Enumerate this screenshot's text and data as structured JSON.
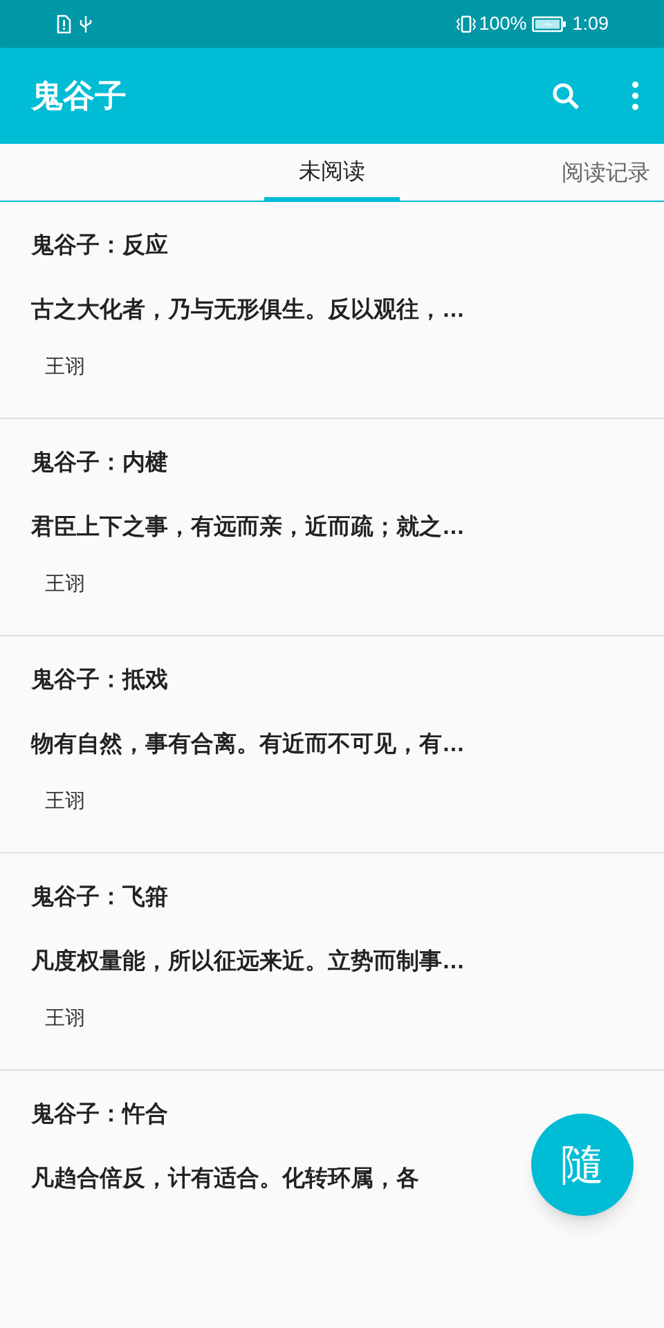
{
  "status_bar": {
    "battery": "100%",
    "time": "1:09"
  },
  "app_bar": {
    "title": "鬼谷子"
  },
  "tabs": [
    {
      "label": "未阅读",
      "selected": true
    },
    {
      "label": "阅读记录",
      "selected": false
    }
  ],
  "articles": [
    {
      "title": "鬼谷子：反应",
      "excerpt": "古之大化者，乃与无形俱生。反以观往，…",
      "author": "王诩"
    },
    {
      "title": "鬼谷子：内楗",
      "excerpt": "君臣上下之事，有远而亲，近而疏；就之…",
      "author": "王诩"
    },
    {
      "title": "鬼谷子：抵戏",
      "excerpt": "物有自然，事有合离。有近而不可见，有…",
      "author": "王诩"
    },
    {
      "title": "鬼谷子：飞箝",
      "excerpt": "凡度权量能，所以征远来近。立势而制事…",
      "author": "王诩"
    },
    {
      "title": "鬼谷子：忤合",
      "excerpt": "凡趋合倍反，计有适合。化转环属，各"
    }
  ],
  "fab": {
    "label": "隨"
  }
}
